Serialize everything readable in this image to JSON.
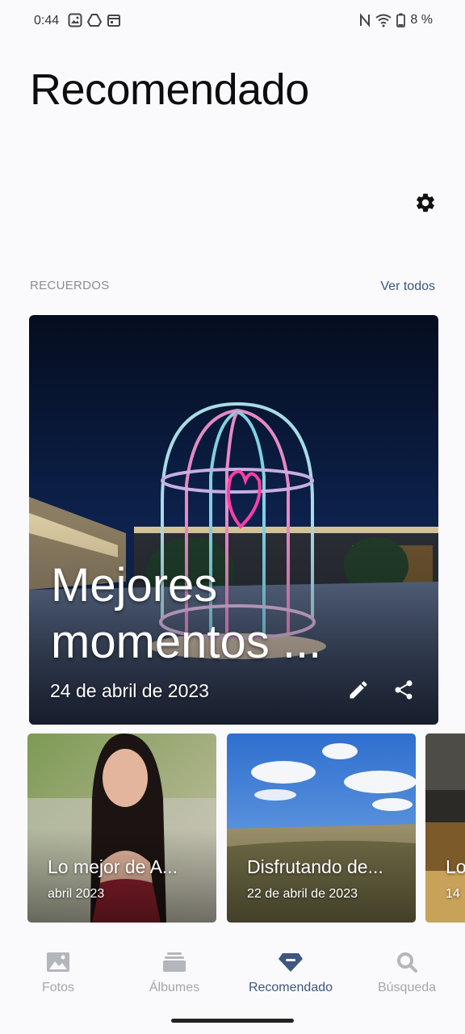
{
  "status_bar": {
    "time": "0:44",
    "battery": "8 %",
    "left_icons": [
      "gallery-icon",
      "drive-icon",
      "calendar-icon"
    ],
    "right_icons": [
      "nfc-icon",
      "wifi-icon",
      "battery-icon"
    ]
  },
  "header": {
    "title": "Recomendado"
  },
  "memories": {
    "section_label": "RECUERDOS",
    "see_all": "Ver todos",
    "featured": {
      "title": "Mejores momentos ...",
      "date": "24 de abril de 2023"
    },
    "cards": [
      {
        "title": "Lo mejor de A...",
        "date": "abril 2023"
      },
      {
        "title": "Disfrutando de...",
        "date": "22 de abril de 2023"
      },
      {
        "title": "Lo",
        "date": "14"
      }
    ]
  },
  "bottom_nav": {
    "items": [
      {
        "label": "Fotos",
        "icon": "photos-icon",
        "active": false
      },
      {
        "label": "Álbumes",
        "icon": "albums-icon",
        "active": false
      },
      {
        "label": "Recomendado",
        "icon": "diamond-icon",
        "active": true
      },
      {
        "label": "Búsqueda",
        "icon": "search-icon",
        "active": false
      }
    ]
  },
  "colors": {
    "background": "#fafafc",
    "accent": "#3e5680",
    "muted_text": "#8a8d93",
    "nav_inactive": "#a3a6ab"
  }
}
